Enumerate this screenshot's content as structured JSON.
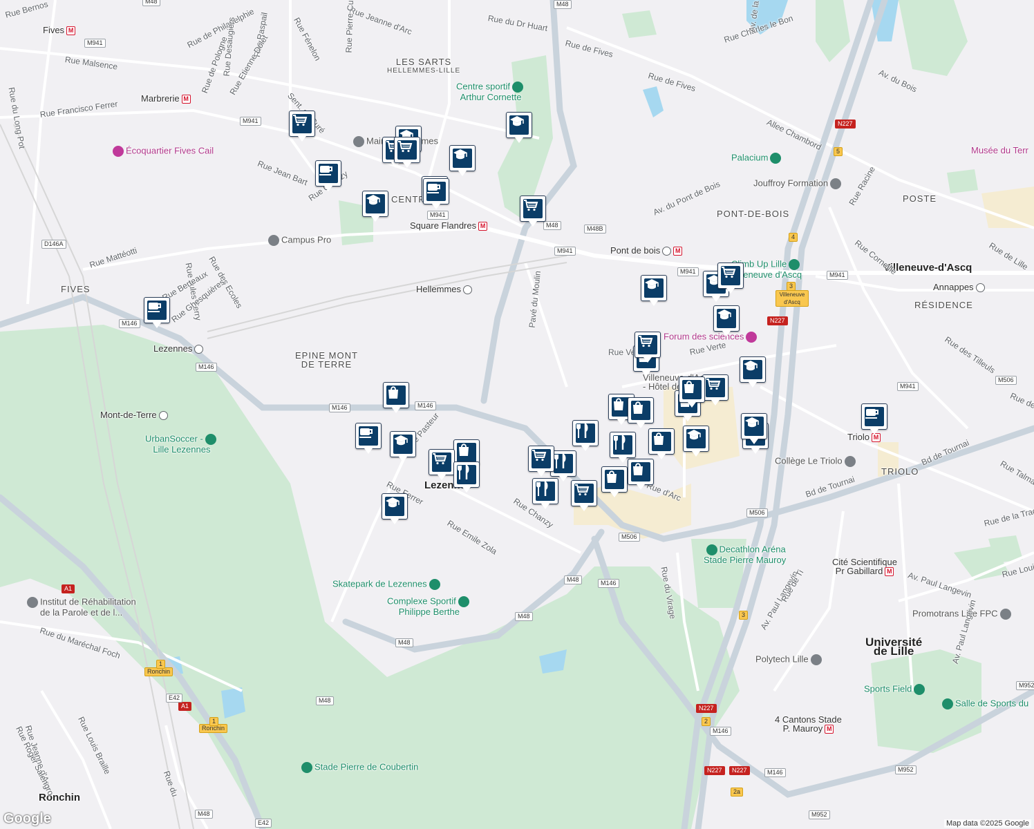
{
  "map": {
    "attribution": "Map data ©2025 Google",
    "logo": "Google",
    "colors": {
      "background": "#f1f0f3",
      "park": "#cfe9d4",
      "water": "#a6d8f0",
      "road": "#ffffff",
      "highway": "#c9d3dc",
      "commercial": "#f5ecd2",
      "marker": "#0b3d67"
    }
  },
  "areas": [
    {
      "id": "les-sarts",
      "text": "LES SARTS",
      "sub": "HELLEMMES-LILLE"
    },
    {
      "id": "fives",
      "text": "FIVES"
    },
    {
      "id": "epine",
      "text": "EPINE MONT",
      "sub": "DE TERRE"
    },
    {
      "id": "pont-de-bois",
      "text": "PONT-DE-BOIS"
    },
    {
      "id": "poste",
      "text": "POSTE"
    },
    {
      "id": "residence",
      "text": "RÉSIDENCE"
    },
    {
      "id": "triolo",
      "text": "TRIOLO"
    },
    {
      "id": "centre",
      "text": "CENTRE"
    }
  ],
  "towns": [
    {
      "id": "villeneuve",
      "text": "Villeneuve-d'Ascq"
    },
    {
      "id": "lezennes",
      "text": "Lezennes"
    },
    {
      "id": "ronchin",
      "text": "Ronchin"
    },
    {
      "id": "universite",
      "text": "Université",
      "sub": "de Lille"
    }
  ],
  "stations": [
    {
      "id": "fives",
      "text": "Fives",
      "type": "metro"
    },
    {
      "id": "marbrerie",
      "text": "Marbrerie",
      "type": "metro"
    },
    {
      "id": "square-flandres",
      "text": "Square Flandres",
      "type": "metro"
    },
    {
      "id": "pont-de-bois",
      "text": "Pont de bois",
      "type": "both"
    },
    {
      "id": "hellemmes",
      "text": "Hellemmes",
      "type": "train"
    },
    {
      "id": "lezennes",
      "text": "Lezennes",
      "type": "train"
    },
    {
      "id": "mont-de-terre",
      "text": "Mont-de-Terre",
      "type": "train"
    },
    {
      "id": "annappes",
      "text": "Annappes",
      "type": "train"
    },
    {
      "id": "triolo",
      "text": "Triolo",
      "type": "metro"
    },
    {
      "id": "cite-scientifique",
      "text": "Cité Scientifique",
      "sub": "Pr Gabillard",
      "type": "metro"
    },
    {
      "id": "4-cantons",
      "text": "4 Cantons Stade",
      "sub": "P. Mauroy",
      "type": "metro"
    }
  ],
  "pois": [
    {
      "id": "centre-sportif",
      "text": "Centre sportif",
      "sub": "Arthur Cornette",
      "color": "g"
    },
    {
      "id": "ecoquartier",
      "text": "Écoquartier Fives Cail",
      "color": "p"
    },
    {
      "id": "campus-pro",
      "text": "Campus Pro",
      "color": "gr"
    },
    {
      "id": "palacium",
      "text": "Palacium",
      "color": "g"
    },
    {
      "id": "jouffroy",
      "text": "Jouffroy Formation",
      "color": "gr"
    },
    {
      "id": "climb-up",
      "text": "Climb Up Lille",
      "sub": "Villeneuve d'Ascq",
      "color": "g"
    },
    {
      "id": "forum",
      "text": "Forum des sciences",
      "color": "p"
    },
    {
      "id": "urbansoccer",
      "text": "UrbanSoccer -",
      "sub": "Lille Lezennes",
      "color": "g"
    },
    {
      "id": "skatepark",
      "text": "Skatepark de Lezennes",
      "color": "g"
    },
    {
      "id": "complexe",
      "text": "Complexe Sportif",
      "sub": "Philippe Berthe",
      "color": "g"
    },
    {
      "id": "college-triolo",
      "text": "Collège Le Triolo",
      "color": "gr"
    },
    {
      "id": "decathlon",
      "text": "Decathlon Aréna",
      "sub": "Stade Pierre Mauroy",
      "color": "g"
    },
    {
      "id": "promotrans",
      "text": "Promotrans Lille FPC",
      "color": "gr"
    },
    {
      "id": "polytech",
      "text": "Polytech Lille",
      "color": "gr"
    },
    {
      "id": "sports-field",
      "text": "Sports Field",
      "color": "g"
    },
    {
      "id": "salle-sports",
      "text": "Salle de Sports du",
      "color": "g"
    },
    {
      "id": "institut",
      "text": "Institut de Réhabilitation",
      "sub": "de la Parole et de l...",
      "color": "gr"
    },
    {
      "id": "stade-coubertin",
      "text": "Stade Pierre de Coubertin",
      "color": "g"
    },
    {
      "id": "musee",
      "text": "Musée du Terr",
      "color": "p"
    },
    {
      "id": "mairie",
      "text": "Mairie Hellemmes",
      "color": "gr"
    },
    {
      "id": "villeneuve-hotel",
      "text": "Villeneuve-d'Ascq",
      "sub": "- Hôtel de ville",
      "color": "gr"
    }
  ],
  "streets": [
    {
      "id": "s1",
      "text": "Rue Bernos"
    },
    {
      "id": "s2",
      "text": "Rue de Philadelphie"
    },
    {
      "id": "s3",
      "text": "Rue Raspail"
    },
    {
      "id": "s4",
      "text": "Rue Fénelon"
    },
    {
      "id": "s5",
      "text": "Rue Jeanne d'Arc"
    },
    {
      "id": "s6",
      "text": "Rue du Dr Huart"
    },
    {
      "id": "s7",
      "text": "Rue de Fives"
    },
    {
      "id": "s8",
      "text": "Rue de Fives"
    },
    {
      "id": "s9",
      "text": "Rue Malsence"
    },
    {
      "id": "s10",
      "text": "Rue du Long Pot"
    },
    {
      "id": "s11",
      "text": "Rue de Pologne"
    },
    {
      "id": "s12",
      "text": "Rue Desaugiers"
    },
    {
      "id": "s13",
      "text": "Rue Pierre Curie"
    },
    {
      "id": "s14",
      "text": "Rue Etienne Dolet"
    },
    {
      "id": "s15",
      "text": "Sent. du Curé"
    },
    {
      "id": "s16",
      "text": "Rue Francisco Ferrer"
    },
    {
      "id": "s17",
      "text": "Rue Jean Bart"
    },
    {
      "id": "s18",
      "text": "Rue Chanzy"
    },
    {
      "id": "s19",
      "text": "Rue Mattéotti"
    },
    {
      "id": "s20",
      "text": "Rue Jules Ferry"
    },
    {
      "id": "s21",
      "text": "Rue des Ecoles"
    },
    {
      "id": "s22",
      "text": "Rue Berteaux"
    },
    {
      "id": "s23",
      "text": "Rue Ghesquières"
    },
    {
      "id": "s24",
      "text": "Av. du Pont de Bois"
    },
    {
      "id": "s25",
      "text": "Rue Charles le Bon"
    },
    {
      "id": "s26",
      "text": "Av. de la Châtellenie"
    },
    {
      "id": "s27",
      "text": "Av. du Bois"
    },
    {
      "id": "s28",
      "text": "Allee Chambord"
    },
    {
      "id": "s29",
      "text": "Rue Racine"
    },
    {
      "id": "s30",
      "text": "Rue Corneille"
    },
    {
      "id": "s31",
      "text": "Rue de Lille"
    },
    {
      "id": "s32",
      "text": "Pavé du Moulin"
    },
    {
      "id": "s33",
      "text": "Rue Verte"
    },
    {
      "id": "s34",
      "text": "Rue Verte"
    },
    {
      "id": "s35",
      "text": "Rue des Tilleuls"
    },
    {
      "id": "s36",
      "text": "Rue Pasteur"
    },
    {
      "id": "s37",
      "text": "Rue Ferrer"
    },
    {
      "id": "s38",
      "text": "Rue Emile Zola"
    },
    {
      "id": "s39",
      "text": "Rue Chanzy"
    },
    {
      "id": "s40",
      "text": "Bd de Tournai"
    },
    {
      "id": "s41",
      "text": "Bd de Tournai"
    },
    {
      "id": "s42",
      "text": "Rue Talma"
    },
    {
      "id": "s43",
      "text": "Rue de la Tradi"
    },
    {
      "id": "s44",
      "text": "Rue du Virage"
    },
    {
      "id": "s45",
      "text": "Av. Paul Langevin"
    },
    {
      "id": "s46",
      "text": "Av. Paul Langevin"
    },
    {
      "id": "s47",
      "text": "Av. Paul Langevin"
    },
    {
      "id": "s48",
      "text": "Rue de Ti"
    },
    {
      "id": "s49",
      "text": "Rue Louis Braille"
    },
    {
      "id": "s50",
      "text": "Rue du Maréchal Foch"
    },
    {
      "id": "s51",
      "text": "Rue Jeanne d'Arc"
    },
    {
      "id": "s52",
      "text": "Rue Roger Salengro"
    },
    {
      "id": "s53",
      "text": "Rue Louis Braille"
    },
    {
      "id": "s54",
      "text": "Rue du"
    },
    {
      "id": "s55",
      "text": "Rue de la Vague"
    },
    {
      "id": "s56",
      "text": "Rue d'Arc"
    }
  ],
  "shields": [
    {
      "id": "m48a",
      "text": "M48"
    },
    {
      "id": "m941a",
      "text": "M941"
    },
    {
      "id": "m941b",
      "text": "M941"
    },
    {
      "id": "m941c",
      "text": "M941"
    },
    {
      "id": "m48b",
      "text": "M48"
    },
    {
      "id": "m48bb",
      "text": "M48B"
    },
    {
      "id": "m941d",
      "text": "M941"
    },
    {
      "id": "m941e",
      "text": "M941"
    },
    {
      "id": "m941f",
      "text": "M941"
    },
    {
      "id": "m941g",
      "text": "M941"
    },
    {
      "id": "d146a",
      "text": "D146A"
    },
    {
      "id": "m146a",
      "text": "M146"
    },
    {
      "id": "m146b",
      "text": "M146"
    },
    {
      "id": "m146c",
      "text": "M146"
    },
    {
      "id": "m146d",
      "text": "M146"
    },
    {
      "id": "m506a",
      "text": "M506"
    },
    {
      "id": "m506b",
      "text": "M506"
    },
    {
      "id": "m506c",
      "text": "M506"
    },
    {
      "id": "m48c",
      "text": "M48"
    },
    {
      "id": "m146e",
      "text": "M146"
    },
    {
      "id": "m48d",
      "text": "M48"
    },
    {
      "id": "m48e",
      "text": "M48"
    },
    {
      "id": "m48f",
      "text": "M48"
    },
    {
      "id": "m48g",
      "text": "M48"
    },
    {
      "id": "n227a",
      "text": "N227",
      "cls": "n"
    },
    {
      "id": "n227b",
      "text": "N227",
      "cls": "n"
    },
    {
      "id": "n227c",
      "text": "N227",
      "cls": "n"
    },
    {
      "id": "n227d",
      "text": "N227",
      "cls": "n"
    },
    {
      "id": "n227e",
      "text": "N227",
      "cls": "n"
    },
    {
      "id": "m146f",
      "text": "M146"
    },
    {
      "id": "m146g",
      "text": "M146"
    },
    {
      "id": "m952a",
      "text": "M952"
    },
    {
      "id": "m952b",
      "text": "M952"
    },
    {
      "id": "m952c",
      "text": "M952"
    },
    {
      "id": "a1a",
      "text": "A1",
      "cls": "n"
    },
    {
      "id": "a1b",
      "text": "A1",
      "cls": "n"
    },
    {
      "id": "e42a",
      "text": "E42"
    },
    {
      "id": "e42b",
      "text": "E42"
    },
    {
      "id": "ronchin1",
      "text": "Ronchin",
      "cls": "y"
    },
    {
      "id": "ronchin2",
      "text": "Ronchin",
      "cls": "y"
    },
    {
      "id": "villeneuve-exit",
      "text": "Villeneuve d'Ascq",
      "cls": "y"
    },
    {
      "id": "ex5",
      "text": "5",
      "cls": "y"
    },
    {
      "id": "ex4",
      "text": "4",
      "cls": "y"
    },
    {
      "id": "ex3",
      "text": "3",
      "cls": "y"
    },
    {
      "id": "ex3b",
      "text": "3",
      "cls": "y"
    },
    {
      "id": "ex2",
      "text": "2",
      "cls": "y"
    },
    {
      "id": "ex2a",
      "text": "2a",
      "cls": "y"
    },
    {
      "id": "ex1",
      "text": "1",
      "cls": "y"
    },
    {
      "id": "ex1b",
      "text": "1",
      "cls": "y"
    }
  ],
  "markers": [
    {
      "icon": "cart"
    },
    {
      "icon": "cafe"
    },
    {
      "icon": "cart"
    },
    {
      "icon": "school"
    },
    {
      "icon": "school"
    },
    {
      "icon": "cafe"
    },
    {
      "icon": "cafe"
    },
    {
      "icon": "school"
    },
    {
      "icon": "cart"
    },
    {
      "icon": "cafe"
    },
    {
      "icon": "school"
    },
    {
      "icon": "cart"
    },
    {
      "icon": "school"
    },
    {
      "icon": "school"
    },
    {
      "icon": "cart"
    },
    {
      "icon": "bag"
    },
    {
      "icon": "bag"
    },
    {
      "icon": "cart"
    },
    {
      "icon": "school"
    },
    {
      "icon": "bag"
    },
    {
      "icon": "cafe"
    },
    {
      "icon": "school"
    },
    {
      "icon": "bag"
    },
    {
      "icon": "cart"
    },
    {
      "icon": "food"
    },
    {
      "icon": "school"
    },
    {
      "icon": "cart"
    },
    {
      "icon": "food"
    },
    {
      "icon": "food"
    },
    {
      "icon": "food"
    },
    {
      "icon": "cart"
    },
    {
      "icon": "bag"
    },
    {
      "icon": "bag"
    },
    {
      "icon": "food"
    },
    {
      "icon": "bag"
    },
    {
      "icon": "bag"
    },
    {
      "icon": "school"
    },
    {
      "icon": "bag"
    },
    {
      "icon": "school"
    },
    {
      "icon": "bag"
    },
    {
      "icon": "school"
    },
    {
      "icon": "cafe"
    },
    {
      "icon": "school"
    },
    {
      "icon": "cart"
    }
  ]
}
